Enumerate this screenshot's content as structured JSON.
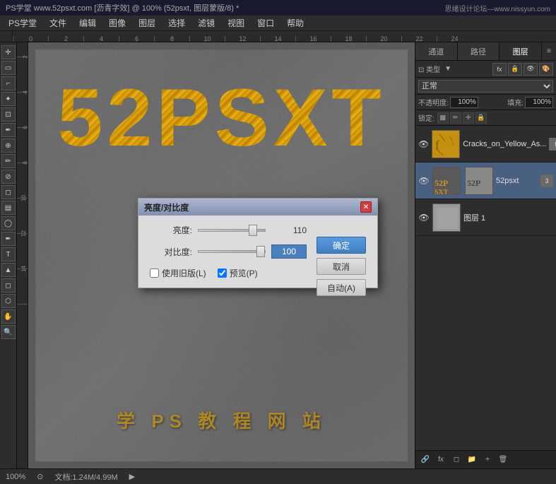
{
  "titlebar": {
    "left": "PS学堂  www.52psxt.com [沥青字效] @ 100% (52psxt, 图层蒙版/8) *",
    "right": "思绪设计论坛—www.nissyun.com"
  },
  "menubar": {
    "items": [
      "PS学堂",
      "文件",
      "编辑",
      "图像",
      "图层",
      "选择",
      "滤镜",
      "视图",
      "窗口",
      "帮助"
    ]
  },
  "canvas": {
    "main_text": "52PSXT",
    "sub_text": "学 PS 教 程 网 站"
  },
  "right_panel": {
    "tabs": [
      "通道",
      "路径",
      "图层"
    ],
    "active_tab": "图层",
    "search_placeholder": "类型",
    "mode": "正常",
    "opacity_label": "不透明度:",
    "opacity_value": "100%",
    "lock_label": "锁定:",
    "fill_label": "填充:",
    "fill_value": "100%",
    "layers": [
      {
        "name": "Cracks_on_Yellow_As...",
        "badge": "f",
        "visible": true,
        "type": "image"
      },
      {
        "name": "52psxt",
        "badge": "3",
        "visible": true,
        "type": "image",
        "selected": true
      },
      {
        "name": "图层 1",
        "badge": "",
        "visible": true,
        "type": "layer"
      }
    ]
  },
  "dialog": {
    "title": "亮度/对比度",
    "brightness_label": "亮度:",
    "brightness_value": "110",
    "contrast_label": "对比度:",
    "contrast_value": "100",
    "confirm_label": "确定",
    "cancel_label": "取消",
    "auto_label": "自动(A)",
    "legacy_label": "使用旧版(L)",
    "preview_label": "预览(P)"
  },
  "statusbar": {
    "zoom": "100%",
    "doc_size": "文档:1.24M/4.99M"
  }
}
